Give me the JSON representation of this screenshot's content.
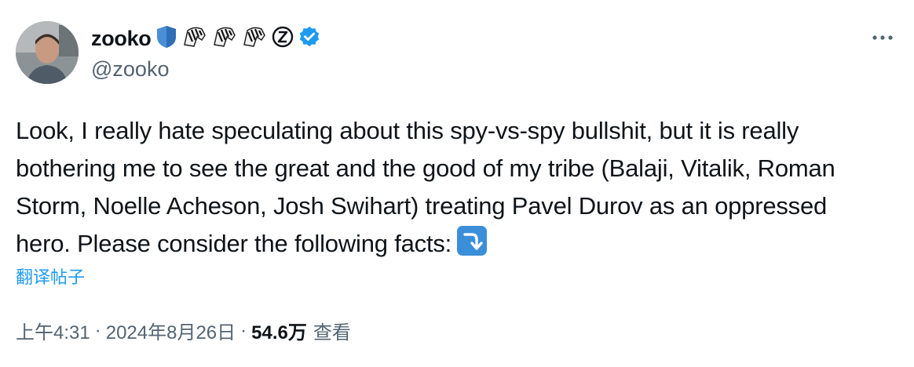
{
  "author": {
    "display_name": "zooko",
    "handle": "@zooko",
    "badges": [
      "shield-emoji",
      "zebra-emoji",
      "zebra-emoji",
      "zebra-emoji",
      "circled-z",
      "verified-badge"
    ]
  },
  "tweet": {
    "text": "Look, I really hate speculating about this spy-vs-spy bullshit, but it is really bothering me to see the great and the good of my tribe (Balaji, Vitalik, Roman Storm, Noelle Acheson, Josh Swihart) treating Pavel Durov as an oppressed hero. Please consider the following facts:",
    "emoji_icon": "right-arrow-curving-down-icon",
    "translate_label": "翻译帖子"
  },
  "meta": {
    "time": "上午4:31",
    "separator": "·",
    "date": "2024年8月26日",
    "views_count": "54.6万",
    "views_label": "查看"
  },
  "colors": {
    "link": "#1d9bf0",
    "secondary_text": "#536471",
    "primary_text": "#0f1419",
    "verified": "#1d9bf0"
  }
}
